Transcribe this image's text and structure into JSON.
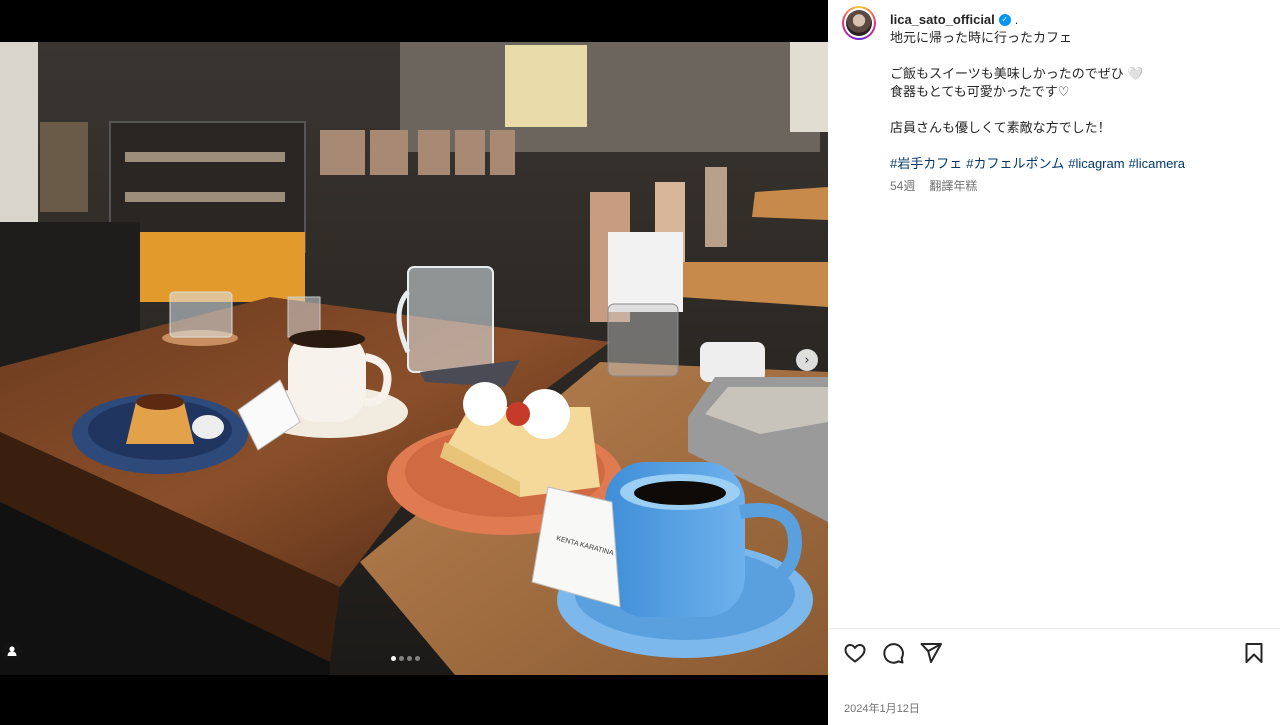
{
  "post": {
    "username": "lica_sato_official",
    "verified_mark": "✓",
    "dot": ".",
    "caption_lines": [
      "地元に帰った時に行ったカフェ",
      "",
      "ご飯もスイーツも美味しかったのでぜひ 🤍",
      "食器もとても可愛かったです♡",
      "",
      "店員さんも優しくて素敵な方でした！"
    ],
    "hashtags": [
      "#岩手カフェ",
      "#カフェルポンム",
      "#licagram",
      "#licamera"
    ],
    "time_ago": "54週",
    "translate_label": "翻譯年糕",
    "date": "2024年1月12日"
  },
  "media": {
    "slide_count": 4,
    "active_slide": 1,
    "next_glyph": "›",
    "receipt_text": "KENTA KARATINA"
  },
  "icons": {
    "like": "heart-icon",
    "comment": "comment-icon",
    "share": "send-icon",
    "save": "bookmark-icon",
    "tag": "user-tag-icon",
    "next": "chevron-right-icon"
  },
  "colors": {
    "hashtag": "#00376b",
    "verified": "#0095f6",
    "meta": "#737373"
  }
}
